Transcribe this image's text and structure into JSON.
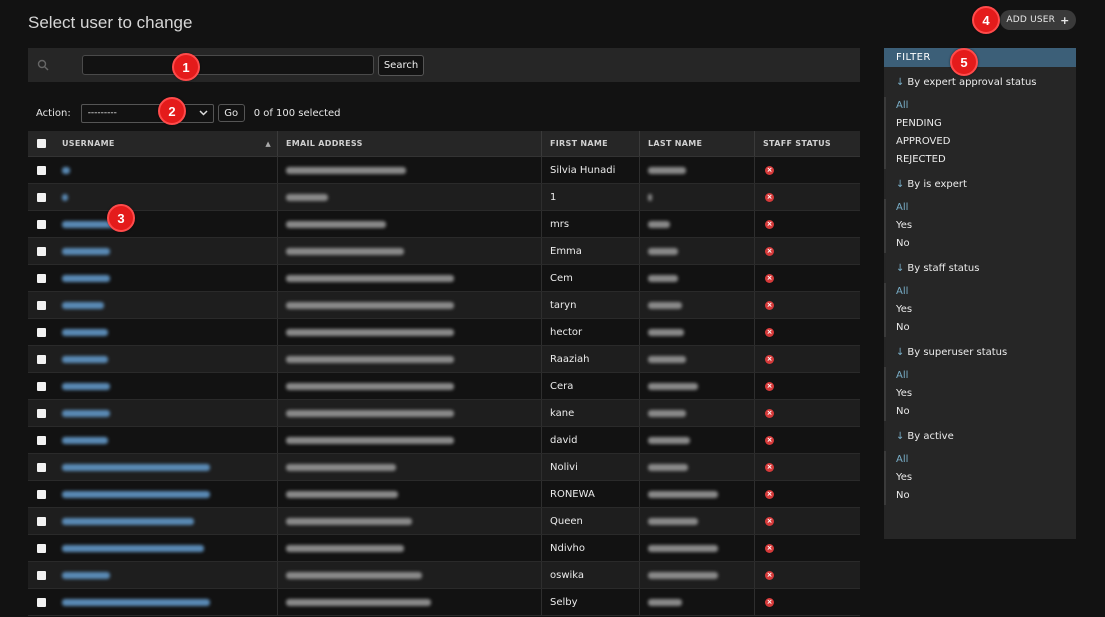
{
  "page": {
    "title": "Select user to change"
  },
  "header": {
    "add_user_label": "ADD USER",
    "add_user_icon": "plus-icon"
  },
  "search": {
    "value": "",
    "placeholder": "",
    "button_label": "Search",
    "icon": "search-icon"
  },
  "actions": {
    "label": "Action:",
    "selected_option": "---------",
    "go_label": "Go",
    "selected_count": "0 of 100 selected"
  },
  "table": {
    "columns": [
      "USERNAME",
      "EMAIL ADDRESS",
      "FIRST NAME",
      "LAST NAME",
      "STAFF STATUS"
    ],
    "sort_indicator": "▲",
    "rows": [
      {
        "first_name": "Silvia Hunadi",
        "staff_icon": "x-icon"
      },
      {
        "first_name": "1",
        "staff_icon": "x-icon"
      },
      {
        "first_name": "mrs",
        "staff_icon": "x-icon"
      },
      {
        "first_name": "Emma",
        "staff_icon": "x-icon"
      },
      {
        "first_name": "Cem",
        "staff_icon": "x-icon"
      },
      {
        "first_name": "taryn",
        "staff_icon": "x-icon"
      },
      {
        "first_name": "hector",
        "staff_icon": "x-icon"
      },
      {
        "first_name": "Raaziah",
        "staff_icon": "x-icon"
      },
      {
        "first_name": "Cera",
        "staff_icon": "x-icon"
      },
      {
        "first_name": "kane",
        "staff_icon": "x-icon"
      },
      {
        "first_name": "david",
        "staff_icon": "x-icon"
      },
      {
        "first_name": "Nolivi",
        "staff_icon": "x-icon"
      },
      {
        "first_name": "RONEWA",
        "staff_icon": "x-icon"
      },
      {
        "first_name": "Queen",
        "staff_icon": "x-icon"
      },
      {
        "first_name": "Ndivho",
        "staff_icon": "x-icon"
      },
      {
        "first_name": "oswika",
        "staff_icon": "x-icon"
      },
      {
        "first_name": "Selby",
        "staff_icon": "x-icon"
      }
    ]
  },
  "filter": {
    "title": "FILTER",
    "groups": [
      {
        "arrow": "↓",
        "title": "By expert approval status",
        "options": [
          "All",
          "PENDING",
          "APPROVED",
          "REJECTED"
        ]
      },
      {
        "arrow": "↓",
        "title": "By is expert",
        "options": [
          "All",
          "Yes",
          "No"
        ]
      },
      {
        "arrow": "↓",
        "title": "By staff status",
        "options": [
          "All",
          "Yes",
          "No"
        ]
      },
      {
        "arrow": "↓",
        "title": "By superuser status",
        "options": [
          "All",
          "Yes",
          "No"
        ]
      },
      {
        "arrow": "↓",
        "title": "By active",
        "options": [
          "All",
          "Yes",
          "No"
        ]
      }
    ]
  },
  "annotations": [
    "1",
    "2",
    "3",
    "4",
    "5"
  ],
  "colors": {
    "accent": "#79aec8",
    "filter_header": "#3c5f78",
    "badge": "#e41b1b",
    "staff_false": "#d63a3a"
  }
}
